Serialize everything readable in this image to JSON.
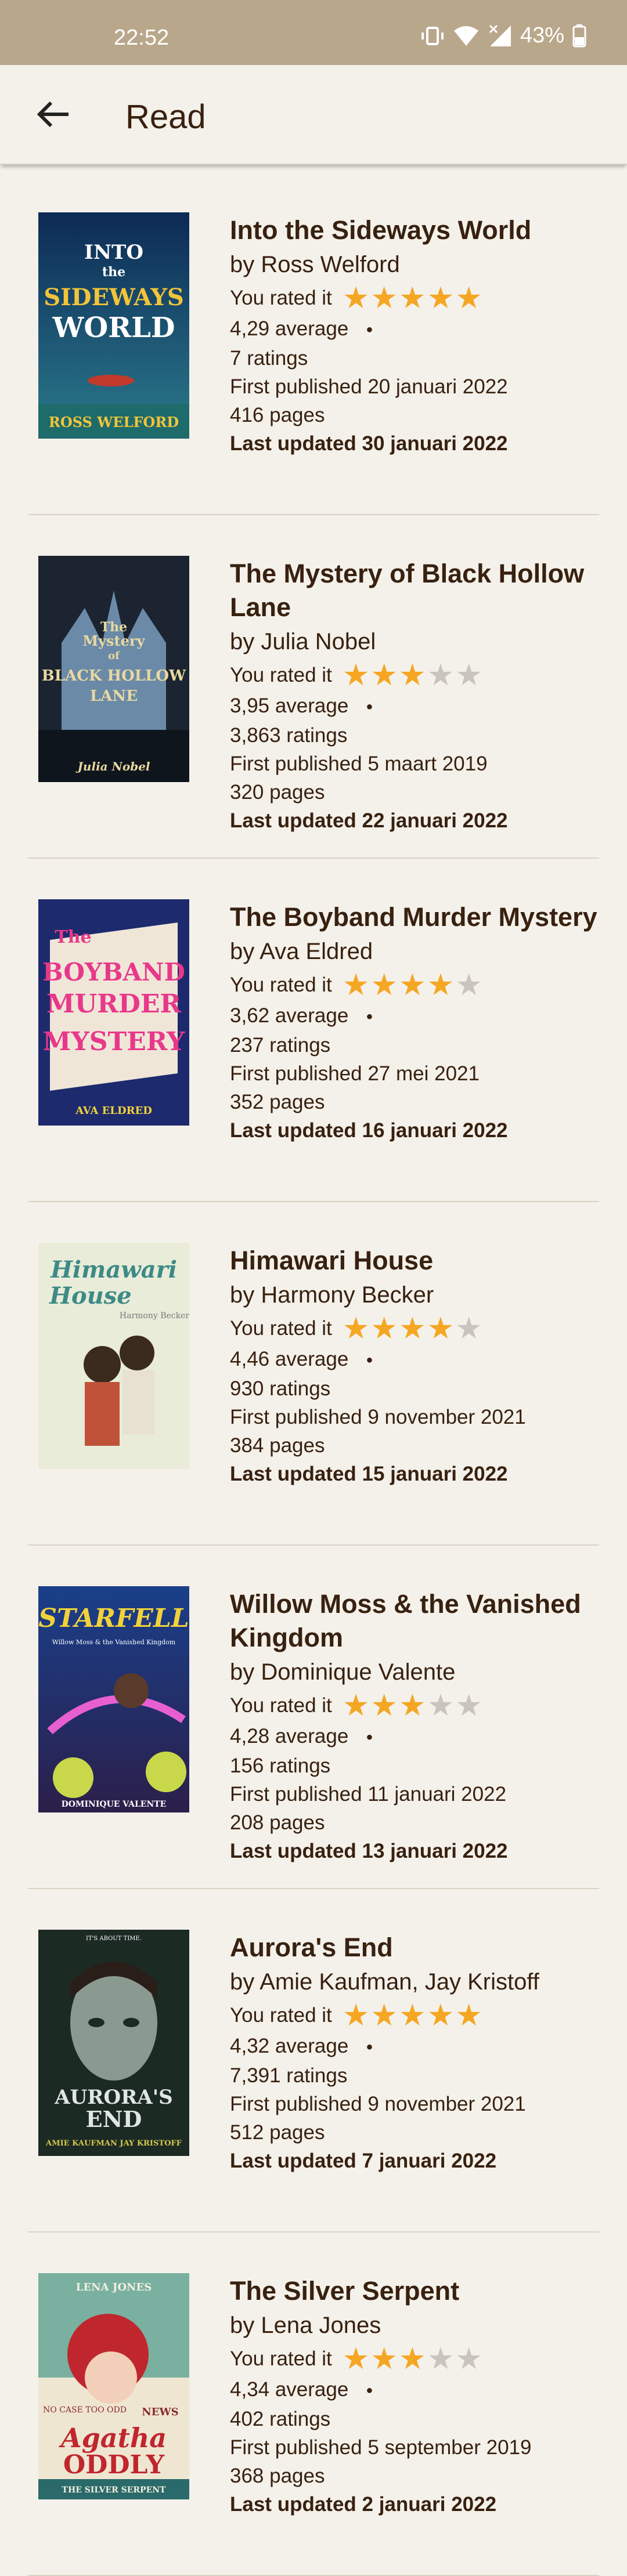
{
  "status_bar": {
    "time": "22:52",
    "battery": "43%"
  },
  "app_bar": {
    "title": "Read"
  },
  "labels": {
    "you_rated": "You rated it"
  },
  "colors": {
    "star_on": "#f5a623",
    "star_off": "#c9c5be",
    "status_bar": "#b9a78c",
    "background": "#f4f1ea"
  },
  "books": [
    {
      "title": "Into the Sideways World",
      "author": "by Ross Welford",
      "user_rating": 5,
      "average": "4,29 average",
      "ratings": "7 ratings",
      "first_published": "First published 20 januari 2022",
      "pages": "416 pages",
      "last_updated": "Last updated 30 januari 2022",
      "cover_text": [
        "INTO",
        "the",
        "SIDEWAYS",
        "WORLD",
        "ROSS WELFORD"
      ]
    },
    {
      "title": "The Mystery of Black Hollow Lane",
      "author": "by Julia Nobel",
      "user_rating": 3,
      "average": "3,95 average",
      "ratings": "3,863 ratings",
      "first_published": "First published 5 maart 2019",
      "pages": "320 pages",
      "last_updated": "Last updated 22 januari 2022",
      "cover_text": [
        "The",
        "Mystery",
        "of",
        "BLACK HOLLOW",
        "LANE",
        "Julia Nobel"
      ]
    },
    {
      "title": "The Boyband Murder Mystery",
      "author": "by Ava Eldred",
      "user_rating": 4,
      "average": "3,62 average",
      "ratings": "237 ratings",
      "first_published": "First published 27 mei 2021",
      "pages": "352 pages",
      "last_updated": "Last updated 16 januari 2022",
      "cover_text": [
        "The",
        "BOYBAND",
        "MURDER",
        "MYSTERY",
        "AVA ELDRED"
      ]
    },
    {
      "title": "Himawari House",
      "author": "by Harmony Becker",
      "user_rating": 4,
      "average": "4,46 average",
      "ratings": "930 ratings",
      "first_published": "First published 9 november 2021",
      "pages": "384 pages",
      "last_updated": "Last updated 15 januari 2022",
      "cover_text": [
        "Himawari",
        "House",
        "Harmony Becker"
      ]
    },
    {
      "title": "Willow Moss & the Vanished Kingdom",
      "author": "by Dominique Valente",
      "user_rating": 3,
      "average": "4,28 average",
      "ratings": "156 ratings",
      "first_published": "First published 11 januari 2022",
      "pages": "208 pages",
      "last_updated": "Last updated 13 januari 2022",
      "cover_text": [
        "STARFELL",
        "Willow Moss & the Vanished Kingdom",
        "DOMINIQUE VALENTE"
      ]
    },
    {
      "title": "Aurora's End",
      "author": "by Amie Kaufman, Jay Kristoff",
      "user_rating": 5,
      "average": "4,32 average",
      "ratings": "7,391 ratings",
      "first_published": "First published 9 november 2021",
      "pages": "512 pages",
      "last_updated": "Last updated 7 januari 2022",
      "cover_text": [
        "IT'S ABOUT TIME.",
        "AURORA'S",
        "END",
        "AMIE KAUFMAN  JAY KRISTOFF"
      ]
    },
    {
      "title": "The Silver Serpent",
      "author": "by Lena Jones",
      "user_rating": 3,
      "average": "4,34 average",
      "ratings": "402 ratings",
      "first_published": "First published 5 september 2019",
      "pages": "368 pages",
      "last_updated": "Last updated 2 januari 2022",
      "cover_text": [
        "LENA JONES",
        "NO CASE TOO ODD",
        "NEWS",
        "Agatha",
        "ODDLY",
        "THE SILVER SERPENT"
      ]
    }
  ]
}
